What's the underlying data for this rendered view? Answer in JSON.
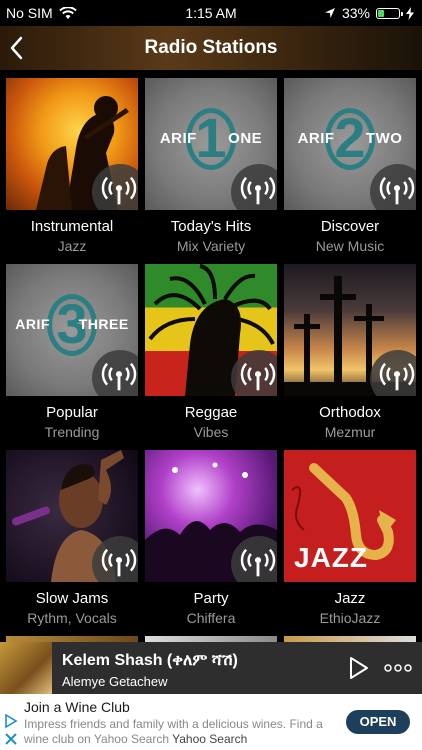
{
  "status_bar": {
    "carrier": "No SIM",
    "time": "1:15 AM",
    "battery": "33%",
    "battery_level": 0.33
  },
  "header": {
    "title": "Radio Stations"
  },
  "stations": [
    {
      "name": "Instrumental",
      "subtitle": "Jazz"
    },
    {
      "name": "Today's Hits",
      "subtitle": "Mix Variety",
      "logo_prefix": "ARIF",
      "logo_number": "1",
      "logo_word": "ONE"
    },
    {
      "name": "Discover",
      "subtitle": "New Music",
      "logo_prefix": "ARIF",
      "logo_number": "2",
      "logo_word": "TWO"
    },
    {
      "name": "Popular",
      "subtitle": "Trending",
      "logo_prefix": "ARIF",
      "logo_number": "3",
      "logo_word": "THREE"
    },
    {
      "name": "Reggae",
      "subtitle": "Vibes"
    },
    {
      "name": "Orthodox",
      "subtitle": "Mezmur"
    },
    {
      "name": "Slow Jams",
      "subtitle": "Rythm, Vocals"
    },
    {
      "name": "Party",
      "subtitle": "Chiffera"
    },
    {
      "name": "Jazz",
      "subtitle": "EthioJazz",
      "logo_word": "JAZZ"
    }
  ],
  "now_playing": {
    "title": "Kelem Shash (ቀለም ሻሽ)",
    "artist": "Alemye Getachew"
  },
  "ad": {
    "title": "Join a Wine Club",
    "text": "Impress friends and family with a delicious wines. Find a wine club on Yahoo Search",
    "source": "Yahoo Search",
    "button": "OPEN"
  },
  "colors": {
    "accent_teal": "#2b7f82",
    "jazz_red": "#c41e1e",
    "battery_green": "#4cd964",
    "ad_button": "#1e3f5c"
  }
}
